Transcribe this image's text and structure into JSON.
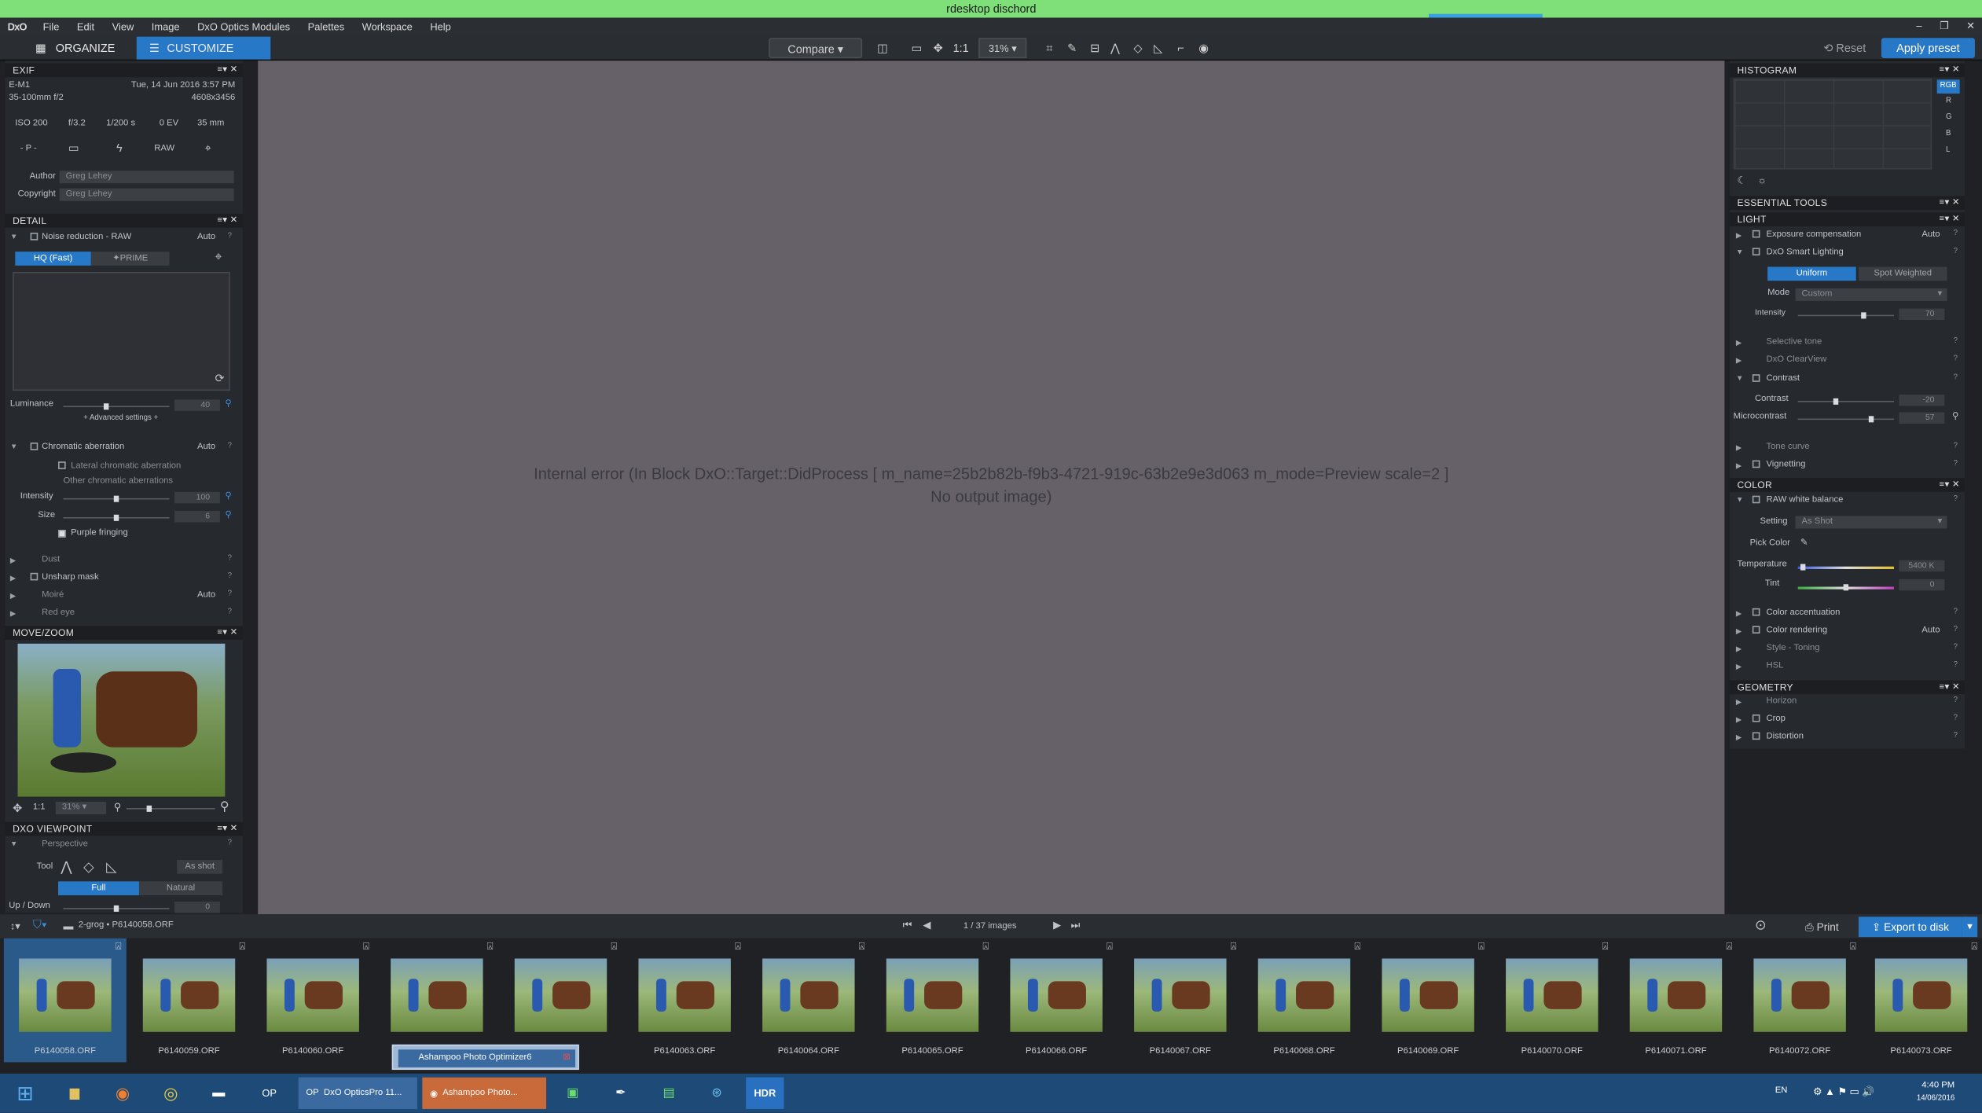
{
  "rdp_title": "rdesktop dischord",
  "menu": {
    "logo": "DxO",
    "items": [
      "File",
      "Edit",
      "View",
      "Image",
      "DxO Optics Modules",
      "Palettes",
      "Workspace",
      "Help"
    ]
  },
  "toolbar": {
    "organize": "ORGANIZE",
    "customize": "CUSTOMIZE",
    "compare": "Compare",
    "ratio": "1:1",
    "zoom": "31%",
    "reset": "Reset",
    "apply_preset": "Apply preset"
  },
  "exif": {
    "title": "EXIF",
    "camera": "E-M1",
    "date": "Tue, 14 Jun 2016 3:57 PM",
    "lens": "35-100mm f/2",
    "dims": "4608x3456",
    "iso": "ISO 200",
    "aperture": "f/3.2",
    "shutter": "1/200 s",
    "ev": "0 EV",
    "focal": "35 mm",
    "mode": "- P -",
    "raw": "RAW",
    "author_label": "Author",
    "author": "Greg Lehey",
    "copyright_label": "Copyright",
    "copyright": "Greg Lehey"
  },
  "detail": {
    "title": "DETAIL",
    "noise": "Noise reduction - RAW",
    "auto": "Auto",
    "hq": "HQ (Fast)",
    "prime": "✦PRIME",
    "luminance": "Luminance",
    "lum_val": "40",
    "advanced": "+ Advanced settings +",
    "chromatic": "Chromatic aberration",
    "lateral": "Lateral chromatic aberration",
    "other": "Other chromatic aberrations",
    "intensity": "Intensity",
    "int_val": "100",
    "size": "Size",
    "size_val": "6",
    "purple": "Purple fringing",
    "dust": "Dust",
    "unsharp": "Unsharp mask",
    "moire": "Moiré",
    "redeye": "Red eye"
  },
  "movezoom": {
    "title": "MOVE/ZOOM",
    "ratio": "1:1",
    "zoom": "31%"
  },
  "viewpoint": {
    "title": "DXO VIEWPOINT",
    "perspective": "Perspective",
    "tool": "Tool",
    "as_shot": "As shot",
    "full": "Full",
    "natural": "Natural",
    "updown": "Up / Down",
    "updown_val": "0"
  },
  "error": {
    "line1": "Internal error (In Block DxO::Target::DidProcess [ m_name=25b2b82b-f9b3-4721-919c-63b2e9e3d063 m_mode=Preview scale=2 ]",
    "line2": "No output image)"
  },
  "histogram": {
    "title": "HISTOGRAM",
    "channels": [
      "RGB",
      "R",
      "G",
      "B",
      "L"
    ]
  },
  "essential": {
    "title": "ESSENTIAL TOOLS"
  },
  "light": {
    "title": "LIGHT",
    "exposure": "Exposure compensation",
    "auto": "Auto",
    "smart": "DxO Smart Lighting",
    "uniform": "Uniform",
    "spot": "Spot Weighted",
    "mode_label": "Mode",
    "mode": "Custom",
    "intensity": "Intensity",
    "int_val": "70",
    "selective": "Selective tone",
    "clearview": "DxO ClearView",
    "contrast": "Contrast",
    "contrast_val": "-20",
    "micro": "Microcontrast",
    "micro_val": "57",
    "tonecurve": "Tone curve",
    "vignetting": "Vignetting"
  },
  "color": {
    "title": "COLOR",
    "wb": "RAW white balance",
    "setting_label": "Setting",
    "setting": "As Shot",
    "pick": "Pick Color",
    "temp": "Temperature",
    "temp_val": "5400 K",
    "tint": "Tint",
    "tint_val": "0",
    "accent": "Color accentuation",
    "render": "Color rendering",
    "auto": "Auto",
    "style": "Style - Toning",
    "hsl": "HSL"
  },
  "geometry": {
    "title": "GEOMETRY",
    "horizon": "Horizon",
    "crop": "Crop",
    "distortion": "Distortion"
  },
  "stripbar": {
    "path": "2-grog • P6140058.ORF",
    "count": "1 / 37 images",
    "print": "Print",
    "export": "Export to disk"
  },
  "thumbs": [
    "P6140058.ORF",
    "P6140059.ORF",
    "P6140060.ORF",
    "",
    "P6140062.ORF",
    "P6140063.ORF",
    "P6140064.ORF",
    "P6140065.ORF",
    "P6140066.ORF",
    "P6140067.ORF",
    "P6140068.ORF",
    "P6140069.ORF",
    "P6140070.ORF",
    "P6140071.ORF",
    "P6140072.ORF",
    "P6140073.ORF"
  ],
  "popup": "Ashampoo Photo Optimizer6",
  "taskbar": {
    "dxo": "DxO OpticsPro 11...",
    "ashampoo": "Ashampoo Photo...",
    "lang": "EN",
    "time": "4:40 PM",
    "date": "14/06/2016",
    "hdr": "HDR"
  }
}
